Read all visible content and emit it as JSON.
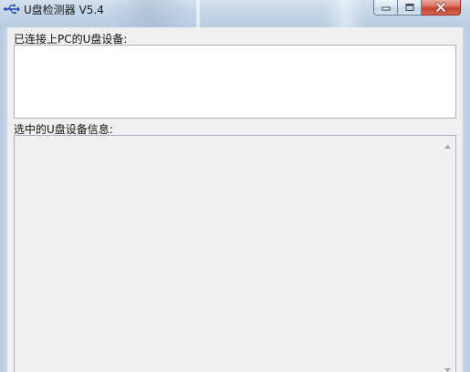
{
  "window": {
    "title": "U盘检测器 V5.4",
    "icon": "usb-icon",
    "caption_buttons": [
      "minimize",
      "maximize",
      "close"
    ]
  },
  "connected_devices": {
    "label": "已连接上PC的U盘设备:",
    "items": []
  },
  "selected_device_info": {
    "label": "选中的U盘设备信息:",
    "content": ""
  },
  "colors": {
    "titlebar": "#c4d5e8",
    "client_bg": "#f0f0f0",
    "list_bg": "#ffffff",
    "close_button": "#c4422b"
  }
}
